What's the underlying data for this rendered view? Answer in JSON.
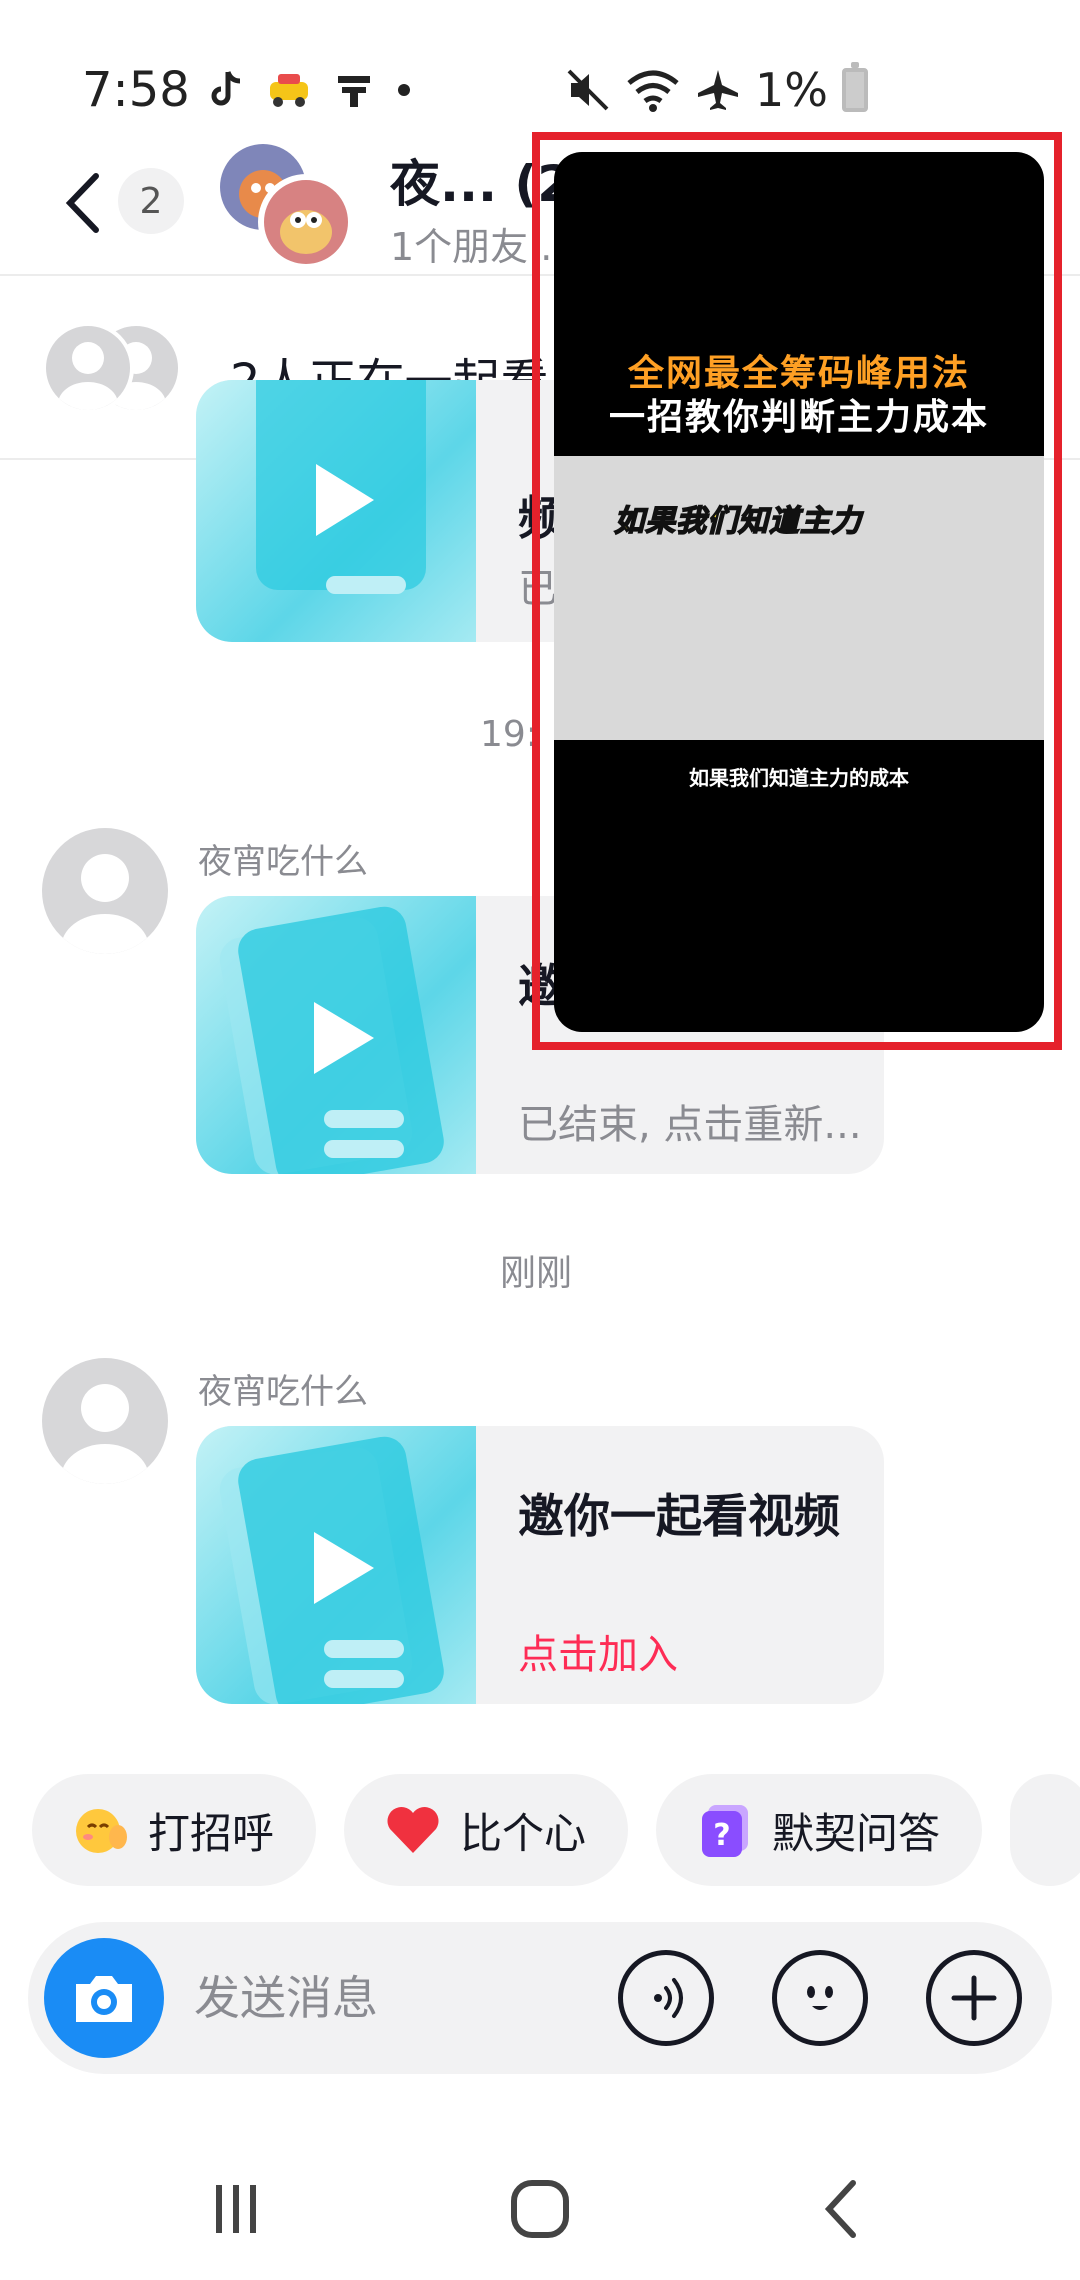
{
  "status_bar": {
    "time": "7:58",
    "battery": "1%"
  },
  "header": {
    "unread_count": "2",
    "title": "夜... (2",
    "subtitle": "1个朋友..."
  },
  "watch_banner": {
    "text": "2人正在一起看"
  },
  "messages": [
    {
      "sender": "",
      "title": "频",
      "subtitle": "已"
    },
    {
      "time": "19:"
    },
    {
      "sender": "夜宵吃什么",
      "title": "邀 频",
      "subtitle": "已结束, 点击重新..."
    },
    {
      "time": "刚刚"
    },
    {
      "sender": "夜宵吃什么",
      "title": "邀你一起看视频",
      "subtitle": "点击加入"
    }
  ],
  "quick_replies": [
    {
      "label": "打招呼",
      "icon": "wave-emoji-icon"
    },
    {
      "label": "比个心",
      "icon": "heart-icon"
    },
    {
      "label": "默契问答",
      "icon": "question-card-icon"
    }
  ],
  "input": {
    "placeholder": "发送消息"
  },
  "floating_video": {
    "title_line1": "全网最全筹码峰用法",
    "title_line2": "一招教你判断主力成本",
    "caption_yellow": "如果我们知道主力",
    "subtitle": "如果我们知道主力的成本",
    "highlight_color": "#e5212b"
  },
  "colors": {
    "accent_blue": "#1a8cf5",
    "accent_pink": "#fe2c55",
    "thumb_cyan": "#5dd6e8"
  }
}
